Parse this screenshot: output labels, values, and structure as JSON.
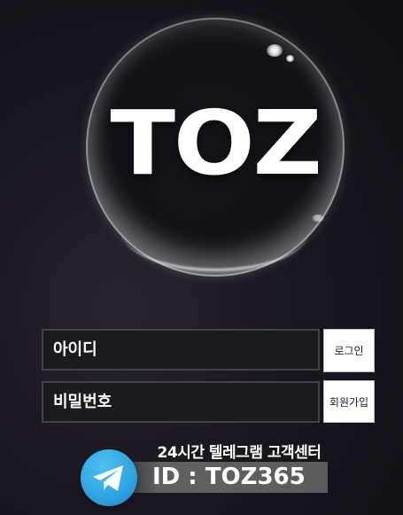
{
  "logo": {
    "text": "TOZ"
  },
  "login_form": {
    "id_placeholder": "아이디",
    "password_placeholder": "비밀번호",
    "login_button": "로그인",
    "signup_button": "회원가입"
  },
  "telegram_banner": {
    "title": "24시간 텔레그램 고객센터",
    "id_text": "ID : TOZ365",
    "icon": "telegram-icon"
  },
  "colors": {
    "input_background": "#1c1b1f",
    "input_border": "#444247",
    "button_background": "#ffffff",
    "telegram_blue": "#2fa3e0"
  }
}
